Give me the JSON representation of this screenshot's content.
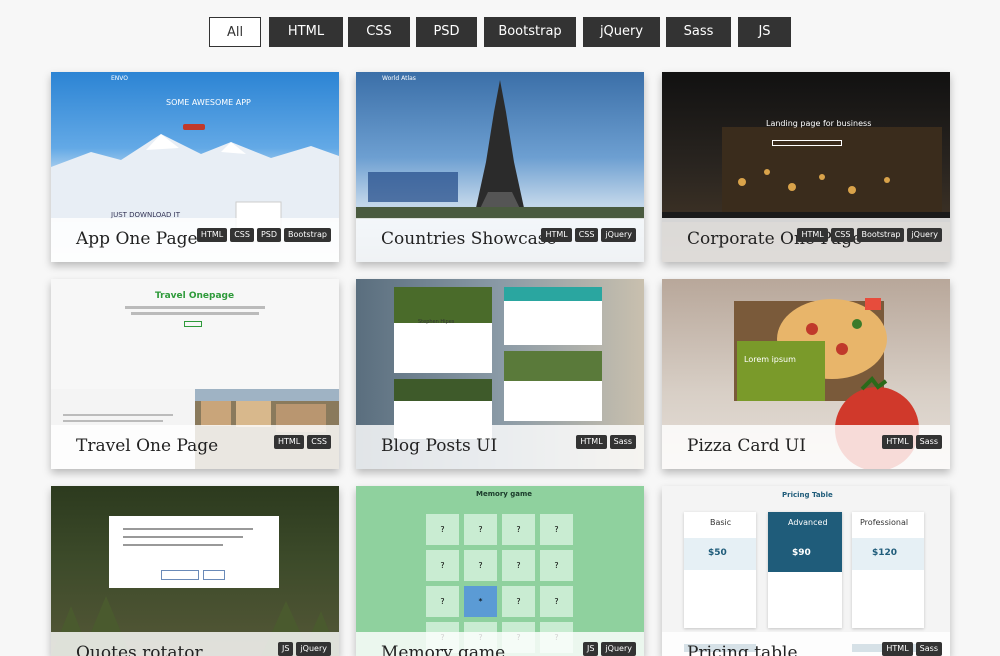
{
  "filters": [
    "All",
    "HTML",
    "CSS",
    "PSD",
    "Bootstrap",
    "jQuery",
    "Sass",
    "JS"
  ],
  "active_filter": "All",
  "cards": [
    {
      "title": "App One Page",
      "tags": [
        "HTML",
        "CSS",
        "PSD",
        "Bootstrap"
      ],
      "preview": {
        "brand": "ENVO",
        "heading": "SOME AWESOME APP",
        "subheading": "JUST DOWNLOAD IT"
      }
    },
    {
      "title": "Countries Showcase",
      "tags": [
        "HTML",
        "CSS",
        "jQuery"
      ],
      "preview": {
        "brand": "World Atlas"
      }
    },
    {
      "title": "Corporate One Page",
      "tags": [
        "HTML",
        "CSS",
        "Bootstrap",
        "jQuery"
      ],
      "preview": {
        "heading": "Landing page for business"
      }
    },
    {
      "title": "Travel One Page",
      "tags": [
        "HTML",
        "CSS"
      ],
      "preview": {
        "heading": "Travel Onepage"
      }
    },
    {
      "title": "Blog Posts UI",
      "tags": [
        "HTML",
        "Sass"
      ],
      "preview": {
        "author": "Stephen Hipes"
      }
    },
    {
      "title": "Pizza Card UI",
      "tags": [
        "HTML",
        "Sass"
      ],
      "preview": {
        "heading": "Lorem ipsum"
      }
    },
    {
      "title": "Quotes rotator",
      "tags": [
        "JS",
        "jQuery"
      ],
      "preview": {}
    },
    {
      "title": "Memory game",
      "tags": [
        "JS",
        "jQuery"
      ],
      "preview": {
        "heading": "Memory game",
        "cells": [
          "?",
          "?",
          "?",
          "?",
          "?",
          "?",
          "?",
          "?",
          "?",
          "*",
          "?",
          "?",
          "?",
          "?",
          "?",
          "?"
        ]
      }
    },
    {
      "title": "Pricing table",
      "tags": [
        "HTML",
        "Sass"
      ],
      "preview": {
        "heading": "Pricing Table",
        "plans": [
          {
            "name": "Basic",
            "price": "$50"
          },
          {
            "name": "Advanced",
            "price": "$90"
          },
          {
            "name": "Professional",
            "price": "$120"
          }
        ]
      }
    }
  ],
  "colors": {
    "filter_bg": "#333333",
    "memory_bg": "#8fd19e",
    "memory_cell": "#c9ecd2",
    "memory_active": "#5b9bd5",
    "pricing_accent": "#1f5c7a"
  }
}
